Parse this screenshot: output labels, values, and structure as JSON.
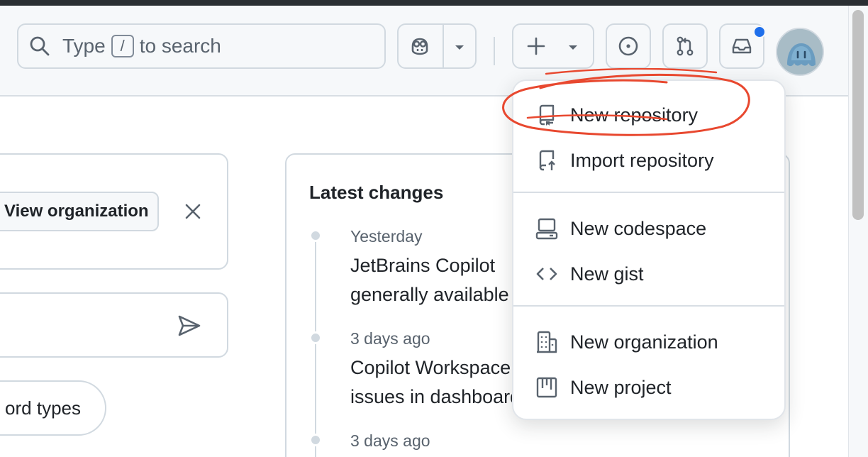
{
  "search": {
    "prefix": "Type",
    "key": "/",
    "suffix": "to search"
  },
  "menu": {
    "items": [
      {
        "label": "New repository",
        "icon": "repo-icon"
      },
      {
        "label": "Import repository",
        "icon": "repo-push-icon"
      },
      {
        "label": "New codespace",
        "icon": "codespaces-icon"
      },
      {
        "label": "New gist",
        "icon": "code-icon"
      },
      {
        "label": "New organization",
        "icon": "organization-icon"
      },
      {
        "label": "New project",
        "icon": "project-icon"
      }
    ]
  },
  "org_card": {
    "view_button": "View organization"
  },
  "pill": {
    "label": "ord types"
  },
  "latest": {
    "title": "Latest changes",
    "items": [
      {
        "date": "Yesterday",
        "line1": "JetBrains Copilot",
        "line2": "generally available"
      },
      {
        "date": "3 days ago",
        "line1": "Copilot Workspace",
        "line2": "issues in dashboard"
      },
      {
        "date": "3 days ago"
      }
    ]
  },
  "colors": {
    "accent": "#1f6feb",
    "annotation": "#e8482f",
    "border": "#d1d9e0"
  }
}
